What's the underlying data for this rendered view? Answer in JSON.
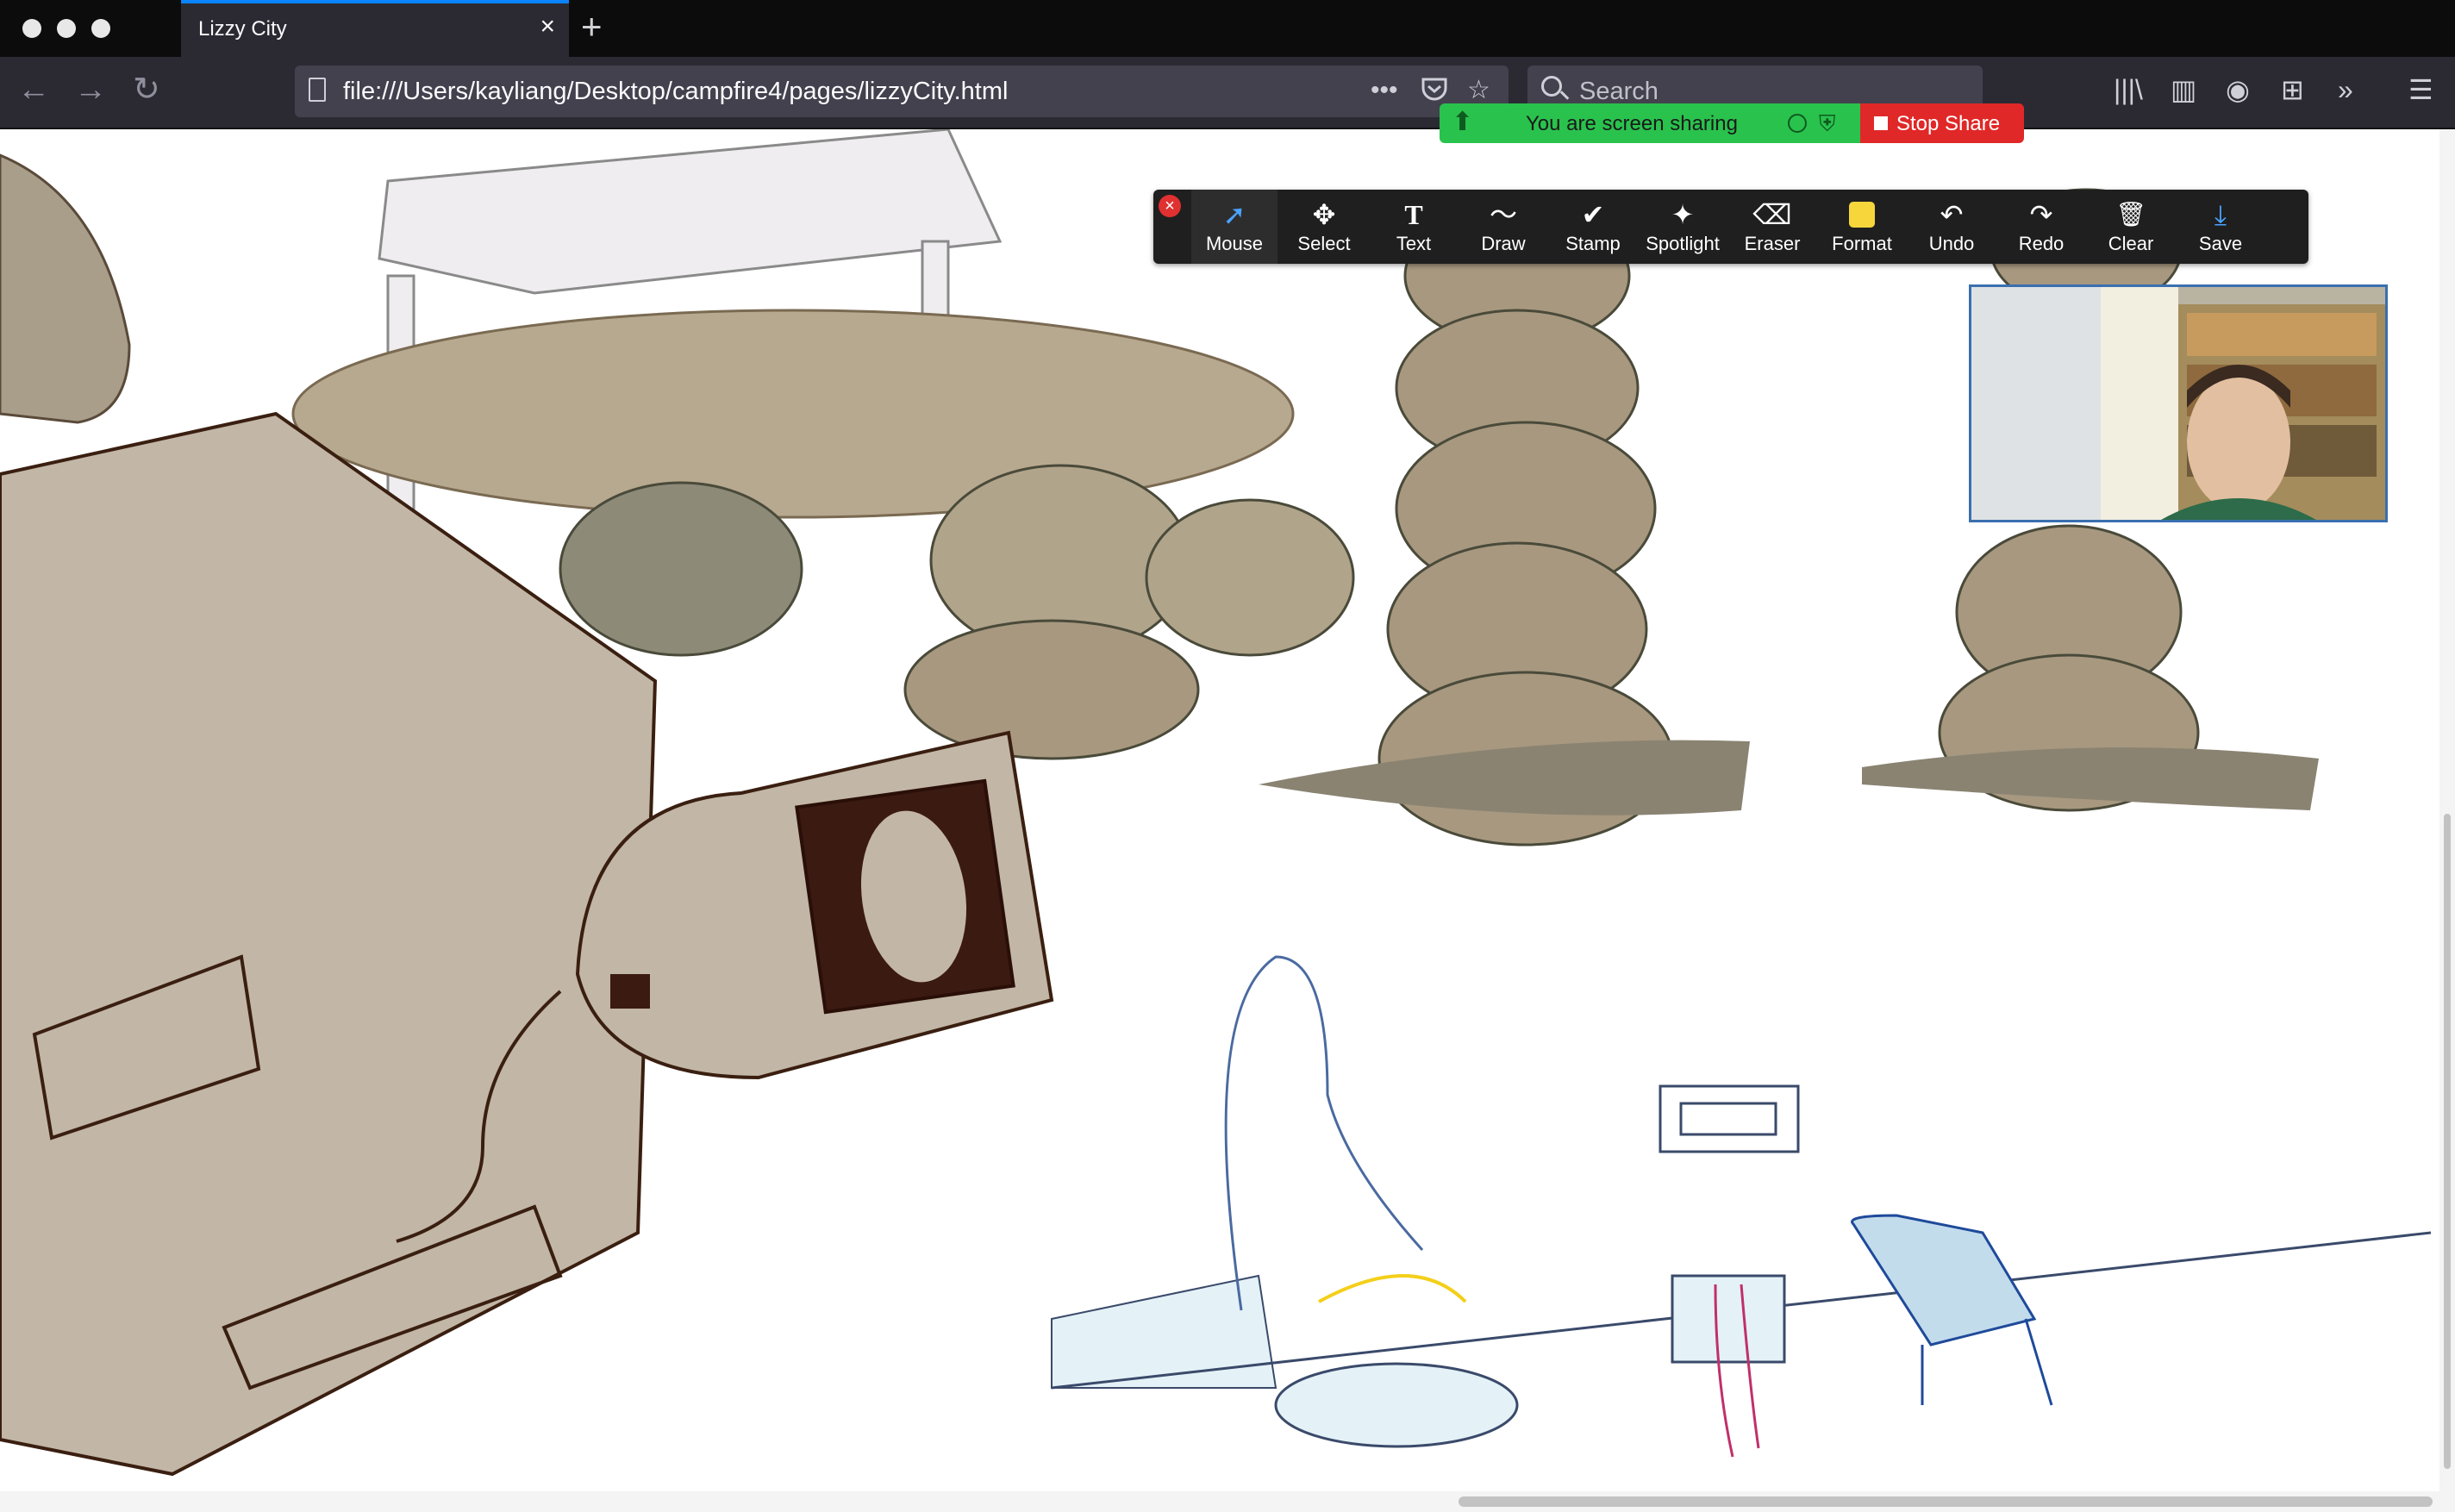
{
  "browser": {
    "tab_title": "Lizzy City",
    "tab_close": "×",
    "new_tab": "+",
    "url": "file:///Users/kayliang/Desktop/campfire4/pages/lizzyCity.html",
    "search_placeholder": "Search",
    "icons": {
      "back": "←",
      "forward": "→",
      "reload": "↻",
      "page_actions": "•••",
      "bookmark": "☆",
      "library": "|||\\",
      "sidebar": "▥",
      "account": "◉",
      "extensions": "⊞",
      "overflow": "»",
      "menu": "☰"
    }
  },
  "screen_share": {
    "status": "You are screen sharing",
    "stop_label": "Stop Share",
    "accent": "#29c24d",
    "stop_color": "#e02828"
  },
  "annotation_toolbar": {
    "tools": [
      {
        "label": "Mouse",
        "icon": "➚"
      },
      {
        "label": "Select",
        "icon": "✥"
      },
      {
        "label": "Text",
        "icon": "T"
      },
      {
        "label": "Draw",
        "icon": "〜"
      },
      {
        "label": "Stamp",
        "icon": "✔"
      },
      {
        "label": "Spotlight",
        "icon": "✦"
      },
      {
        "label": "Eraser",
        "icon": "⌫"
      },
      {
        "label": "Format",
        "icon": ""
      },
      {
        "label": "Undo",
        "icon": "↶"
      },
      {
        "label": "Redo",
        "icon": "↷"
      },
      {
        "label": "Clear",
        "icon": "🗑"
      },
      {
        "label": "Save",
        "icon": "⤓"
      }
    ],
    "format_color": "#f7d63b"
  }
}
